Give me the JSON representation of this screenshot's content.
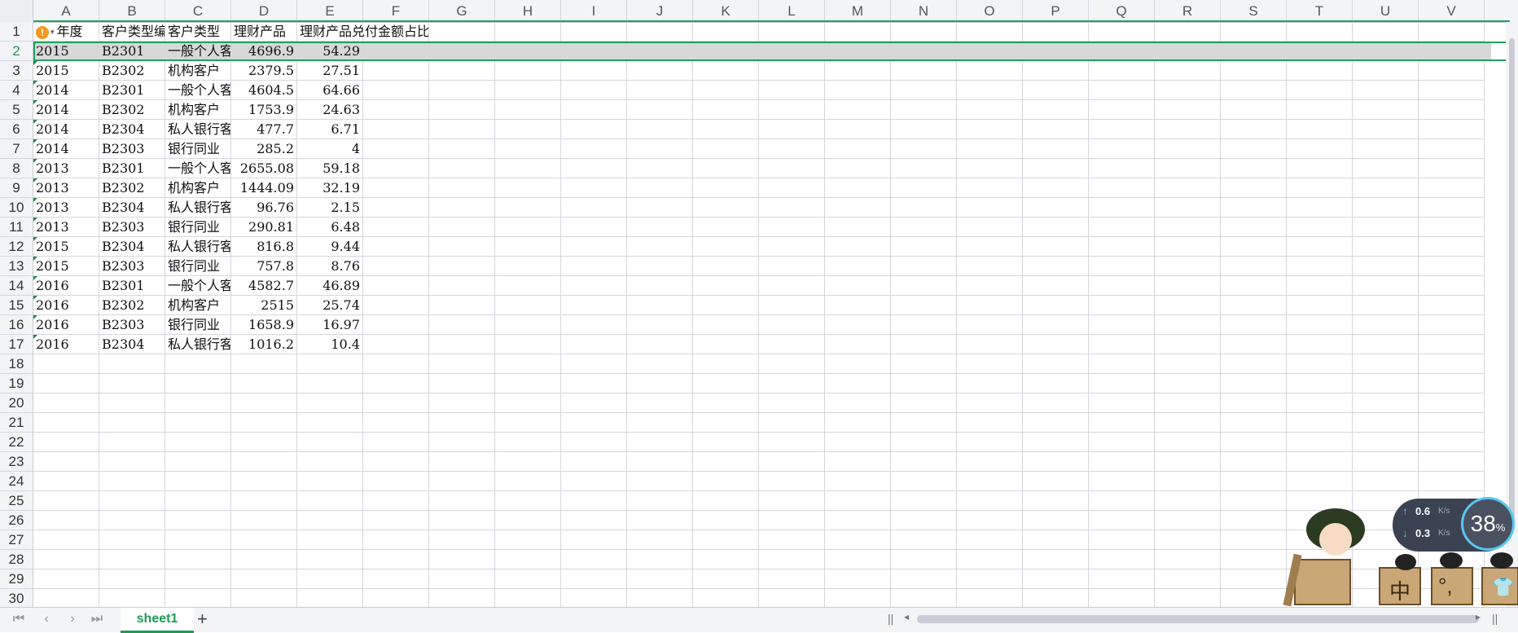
{
  "columns": [
    "A",
    "B",
    "C",
    "D",
    "E",
    "F",
    "G",
    "H",
    "I",
    "J",
    "K",
    "L",
    "M",
    "N",
    "O",
    "P",
    "Q",
    "R",
    "S",
    "T",
    "U",
    "V"
  ],
  "row_numbers": [
    "1",
    "2",
    "3",
    "4",
    "5",
    "6",
    "7",
    "8",
    "9",
    "10",
    "11",
    "12",
    "13",
    "14",
    "15",
    "16",
    "17",
    "18",
    "19",
    "20",
    "21",
    "22",
    "23",
    "24",
    "25",
    "26",
    "27",
    "28",
    "29",
    "30"
  ],
  "header": {
    "a": "年度",
    "b": "客户类型编",
    "c": "客户类型",
    "d": "理财产品",
    "e": "理财产品兑付金额占比"
  },
  "rows": [
    [
      "2015",
      "B2301",
      "一般个人客户",
      "4696.9",
      "54.29"
    ],
    [
      "2015",
      "B2302",
      "机构客户",
      "2379.5",
      "27.51"
    ],
    [
      "2014",
      "B2301",
      "一般个人客户",
      "4604.5",
      "64.66"
    ],
    [
      "2014",
      "B2302",
      "机构客户",
      "1753.9",
      "24.63"
    ],
    [
      "2014",
      "B2304",
      "私人银行客户",
      "477.7",
      "6.71"
    ],
    [
      "2014",
      "B2303",
      "银行同业",
      "285.2",
      "4"
    ],
    [
      "2013",
      "B2301",
      "一般个人客户",
      "2655.08",
      "59.18"
    ],
    [
      "2013",
      "B2302",
      "机构客户",
      "1444.09",
      "32.19"
    ],
    [
      "2013",
      "B2304",
      "私人银行客户",
      "96.76",
      "2.15"
    ],
    [
      "2013",
      "B2303",
      "银行同业",
      "290.81",
      "6.48"
    ],
    [
      "2015",
      "B2304",
      "私人银行客户",
      "816.8",
      "9.44"
    ],
    [
      "2015",
      "B2303",
      "银行同业",
      "757.8",
      "8.76"
    ],
    [
      "2016",
      "B2301",
      "一般个人客户",
      "4582.7",
      "46.89"
    ],
    [
      "2016",
      "B2302",
      "机构客户",
      "2515",
      "25.74"
    ],
    [
      "2016",
      "B2303",
      "银行同业",
      "1658.9",
      "16.97"
    ],
    [
      "2016",
      "B2304",
      "私人银行客户",
      "1016.2",
      "10.4"
    ]
  ],
  "sheet_tab": "sheet1",
  "widget": {
    "upload": "0.6",
    "download": "0.3",
    "unit": "K/s",
    "percent": "38",
    "percent_sign": "%"
  },
  "mascot_keys": [
    "中",
    "°,"
  ],
  "colors": {
    "accent": "#1ea260",
    "warning": "#f29a1f"
  }
}
